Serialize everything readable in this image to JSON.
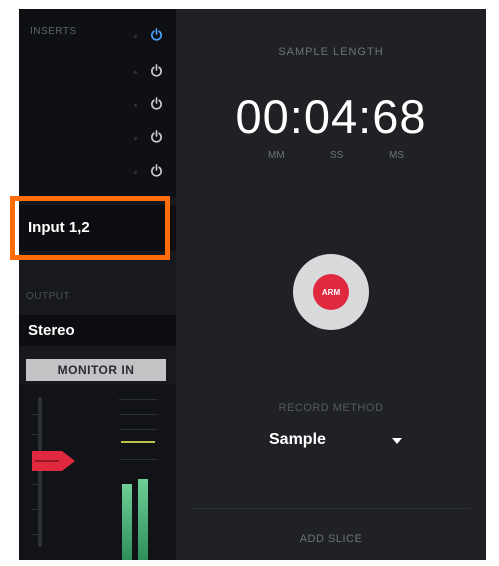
{
  "inserts": {
    "title": "INSERTS",
    "slots": [
      {
        "power_icon": "power-icon",
        "active": true
      },
      {
        "power_icon": "power-icon",
        "active": false
      },
      {
        "power_icon": "power-icon",
        "active": false
      },
      {
        "power_icon": "power-icon",
        "active": false
      },
      {
        "power_icon": "power-icon",
        "active": false
      }
    ]
  },
  "input": {
    "value": "Input 1,2"
  },
  "output": {
    "title": "OUTPUT",
    "value": "Stereo"
  },
  "monitor": {
    "label": "MONITOR IN"
  },
  "sample": {
    "length_label": "SAMPLE LENGTH",
    "time": "00:04:68",
    "units": [
      "MM",
      "SS",
      "MS"
    ]
  },
  "record": {
    "button_label": "ARM"
  },
  "record_method": {
    "label": "RECORD METHOD",
    "value": "Sample"
  },
  "add_slice": {
    "label": "ADD SLICE"
  },
  "colors": {
    "accent_blue": "#4aa3ff",
    "record_red": "#e0293f",
    "record_ring": "#d9dadc",
    "highlight_orange": "#ff6c0a",
    "meter_green": "#6fcf97"
  }
}
